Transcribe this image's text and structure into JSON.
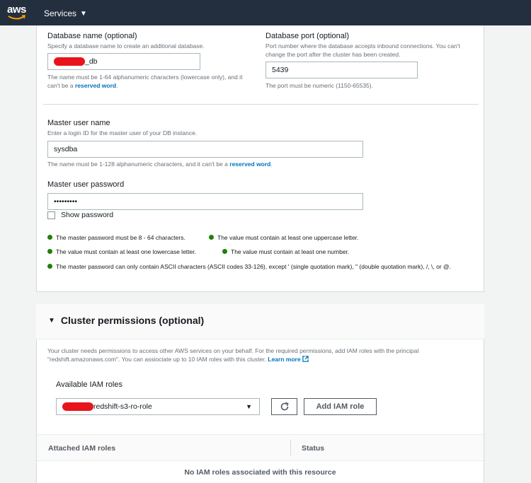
{
  "topnav": {
    "logo_text": "aws",
    "services_label": "Services"
  },
  "database_name": {
    "label": "Database name (optional)",
    "description": "Specify a database name to create an additional database.",
    "value_suffix": "_db",
    "hint_prefix": "The name must be 1-64 alphanumeric characters (lowercase only), and it can't be a",
    "hint_link": "reserved word",
    "hint_suffix": "."
  },
  "database_port": {
    "label": "Database port (optional)",
    "description": "Port number where the database accepts inbound connections. You can't change the port after the cluster has been created.",
    "value": "5439",
    "hint": "The port must be numeric (1150-65535)."
  },
  "master_user": {
    "label": "Master user name",
    "description": "Enter a login ID for the master user of your DB instance.",
    "value": "sysdba",
    "hint_prefix": "The name must be 1-128 alphanumeric characters, and it can't be a",
    "hint_link": "reserved word",
    "hint_suffix": "."
  },
  "master_password": {
    "label": "Master user password",
    "value": "•••••••••",
    "show_password_label": "Show password",
    "rules": [
      "The master password must be 8 - 64 characters.",
      "The value must contain at least one uppercase letter.",
      "The value must contain at least one lowercase letter.",
      "The value must contain at least one number.",
      "The master password can only contain ASCII characters (ASCII codes 33-126), except ' (single quotation mark), \" (double quotation mark), /, \\, or @."
    ],
    "rule_color": "#1d8102"
  },
  "cluster_permissions": {
    "title": "Cluster permissions (optional)",
    "description": "Your cluster needs permissions to access other AWS services on your behalf. For the required permissions, add IAM roles with the principal \"redshift.amazonaws.com\". You can assiociate up to 10 IAM roles with this cluster.",
    "learn_more": "Learn more",
    "available_roles_label": "Available IAM roles",
    "selected_role_suffix": "redshift-s3-ro-role",
    "add_button": "Add IAM role",
    "table": {
      "col_roles": "Attached IAM roles",
      "col_status": "Status",
      "empty": "No IAM roles associated with this resource"
    }
  },
  "colors": {
    "nav_bg": "#232f3e",
    "link": "#0073bb",
    "logo_orange": "#ff9900",
    "redaction": "#e8141c"
  }
}
